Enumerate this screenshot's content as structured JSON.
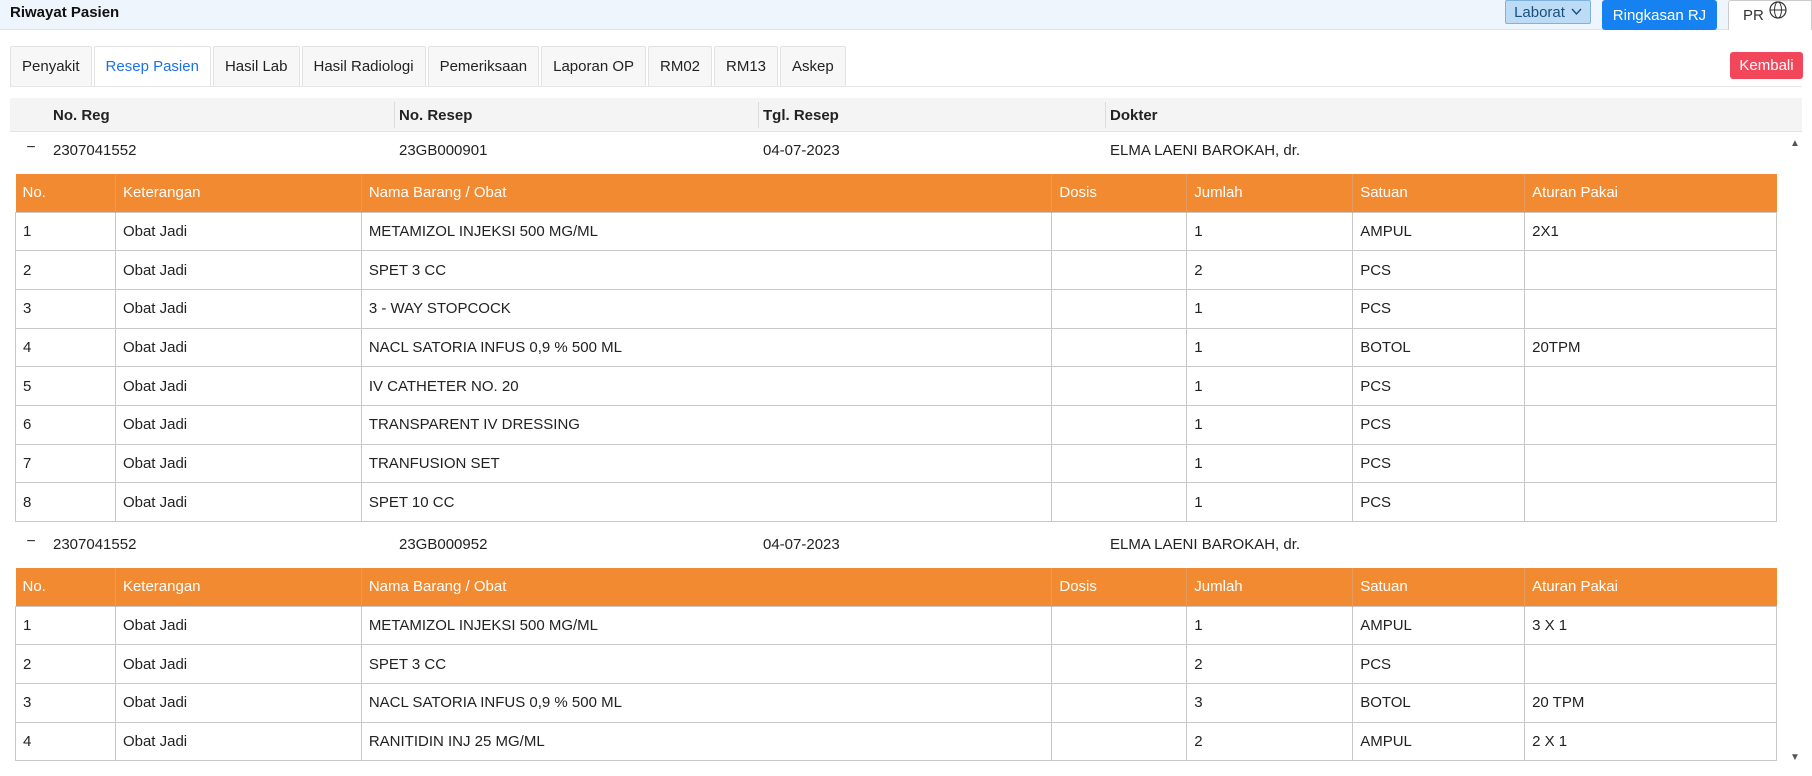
{
  "header": {
    "title": "Riwayat Pasien",
    "laborat_label": "Laborat",
    "ringkasan_label": "Ringkasan RJ",
    "pr_label": "PR"
  },
  "tabs": [
    {
      "label": "Penyakit",
      "active": false
    },
    {
      "label": "Resep Pasien",
      "active": true
    },
    {
      "label": "Hasil Lab",
      "active": false
    },
    {
      "label": "Hasil Radiologi",
      "active": false
    },
    {
      "label": "Pemeriksaan",
      "active": false
    },
    {
      "label": "Laporan OP",
      "active": false
    },
    {
      "label": "RM02",
      "active": false
    },
    {
      "label": "RM13",
      "active": false
    },
    {
      "label": "Askep",
      "active": false
    }
  ],
  "kembali_label": "Kembali",
  "master": {
    "columns": [
      "No. Reg",
      "No. Resep",
      "Tgl. Resep",
      "Dokter"
    ],
    "toggle_symbol": "−"
  },
  "detail_columns": [
    "No.",
    "Keterangan",
    "Nama Barang / Obat",
    "Dosis",
    "Jumlah",
    "Satuan",
    "Aturan Pakai"
  ],
  "records": [
    {
      "no_reg": "2307041552",
      "no_resep": "23GB000901",
      "tgl_resep": "04-07-2023",
      "dokter": "ELMA LAENI BAROKAH, dr.",
      "items": [
        [
          "1",
          "Obat Jadi",
          "METAMIZOL INJEKSI 500 MG/ML",
          "",
          "1",
          "AMPUL",
          "2X1"
        ],
        [
          "2",
          "Obat Jadi",
          "SPET 3 CC",
          "",
          "2",
          "PCS",
          ""
        ],
        [
          "3",
          "Obat Jadi",
          "3 - WAY STOPCOCK",
          "",
          "1",
          "PCS",
          ""
        ],
        [
          "4",
          "Obat Jadi",
          "NACL SATORIA INFUS 0,9 % 500 ML",
          "",
          "1",
          "BOTOL",
          "20TPM"
        ],
        [
          "5",
          "Obat Jadi",
          "IV CATHETER NO. 20",
          "",
          "1",
          "PCS",
          ""
        ],
        [
          "6",
          "Obat Jadi",
          "TRANSPARENT IV DRESSING",
          "",
          "1",
          "PCS",
          ""
        ],
        [
          "7",
          "Obat Jadi",
          "TRANFUSION SET",
          "",
          "1",
          "PCS",
          ""
        ],
        [
          "8",
          "Obat Jadi",
          "SPET 10 CC",
          "",
          "1",
          "PCS",
          ""
        ]
      ]
    },
    {
      "no_reg": "2307041552",
      "no_resep": "23GB000952",
      "tgl_resep": "04-07-2023",
      "dokter": "ELMA LAENI BAROKAH, dr.",
      "items": [
        [
          "1",
          "Obat Jadi",
          "METAMIZOL INJEKSI 500 MG/ML",
          "",
          "1",
          "AMPUL",
          "3 X 1"
        ],
        [
          "2",
          "Obat Jadi",
          "SPET 3 CC",
          "",
          "2",
          "PCS",
          ""
        ],
        [
          "3",
          "Obat Jadi",
          "NACL SATORIA INFUS 0,9 % 500 ML",
          "",
          "3",
          "BOTOL",
          "20 TPM"
        ],
        [
          "4",
          "Obat Jadi",
          "RANITIDIN INJ 25 MG/ML",
          "",
          "2",
          "AMPUL",
          "2 X 1"
        ]
      ]
    }
  ],
  "colors": {
    "accent_blue": "#1681f0",
    "table_header_orange": "#f18a31",
    "kembali_red": "#f2475a"
  },
  "icons": {
    "laborat_dropdown": "chevron-down-icon",
    "pr_logo": "globe-icon",
    "toggle": "collapse-icon",
    "scroll_up": "scroll-up-icon",
    "scroll_down": "scroll-down-icon"
  }
}
